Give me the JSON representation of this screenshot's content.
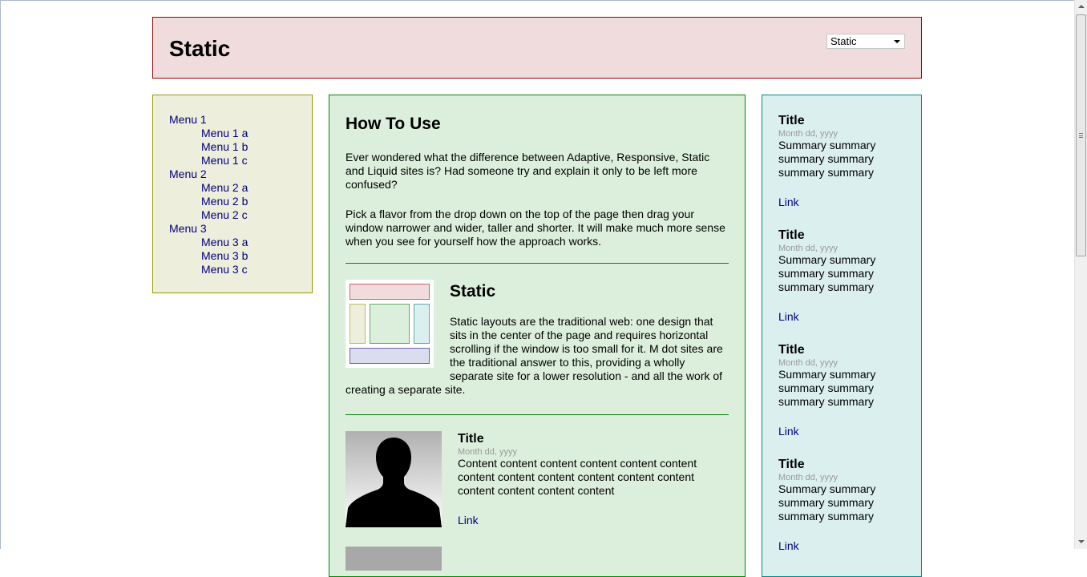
{
  "header": {
    "title": "Static",
    "flavor_select": {
      "selected": "Static"
    }
  },
  "nav": {
    "items": [
      {
        "label": "Menu 1",
        "level": 1
      },
      {
        "label": "Menu 1 a",
        "level": 2
      },
      {
        "label": "Menu 1 b",
        "level": 2
      },
      {
        "label": "Menu 1 c",
        "level": 2
      },
      {
        "label": "Menu 2",
        "level": 1
      },
      {
        "label": "Menu 2 a",
        "level": 2
      },
      {
        "label": "Menu 2 b",
        "level": 2
      },
      {
        "label": "Menu 2 c",
        "level": 2
      },
      {
        "label": "Menu 3",
        "level": 1
      },
      {
        "label": "Menu 3 a",
        "level": 2
      },
      {
        "label": "Menu 3 b",
        "level": 2
      },
      {
        "label": "Menu 3 c",
        "level": 2
      }
    ]
  },
  "main": {
    "heading": "How To Use",
    "paragraph1": "Ever wondered what the difference between Adaptive, Responsive, Static and Liquid sites is? Had someone try and explain it only to be left more confused?",
    "paragraph2": "Pick a flavor from the drop down on the top of the page then drag your window narrower and wider, taller and shorter. It will make much more sense when you see for yourself how the approach works.",
    "flavor": {
      "title": "Static",
      "description": "Static layouts are the traditional web: one design that sits in the center of the page and requires horizontal scrolling if the window is too small for it. M dot sites are the traditional answer to this, providing a wholly separate site for a lower resolution - and all the work of creating a separate site."
    },
    "articles": [
      {
        "title": "Title",
        "date": "Month dd, yyyy",
        "content": "Content content content content content content content content content content content content content content content content",
        "link": "Link"
      }
    ]
  },
  "sidebar": {
    "items": [
      {
        "title": "Title",
        "date": "Month dd, yyyy",
        "summary": "Summary summary summary summary summary summary",
        "link": "Link"
      },
      {
        "title": "Title",
        "date": "Month dd, yyyy",
        "summary": "Summary summary summary summary summary summary",
        "link": "Link"
      },
      {
        "title": "Title",
        "date": "Month dd, yyyy",
        "summary": "Summary summary summary summary summary summary",
        "link": "Link"
      },
      {
        "title": "Title",
        "date": "Month dd, yyyy",
        "summary": "Summary summary summary summary summary summary",
        "link": "Link"
      }
    ]
  },
  "colors": {
    "header_bg": "#f0dcdc",
    "nav_bg": "#eeeedc",
    "main_bg": "#dcefdc",
    "sidebar_bg": "#dcefef",
    "link": "#000080"
  }
}
